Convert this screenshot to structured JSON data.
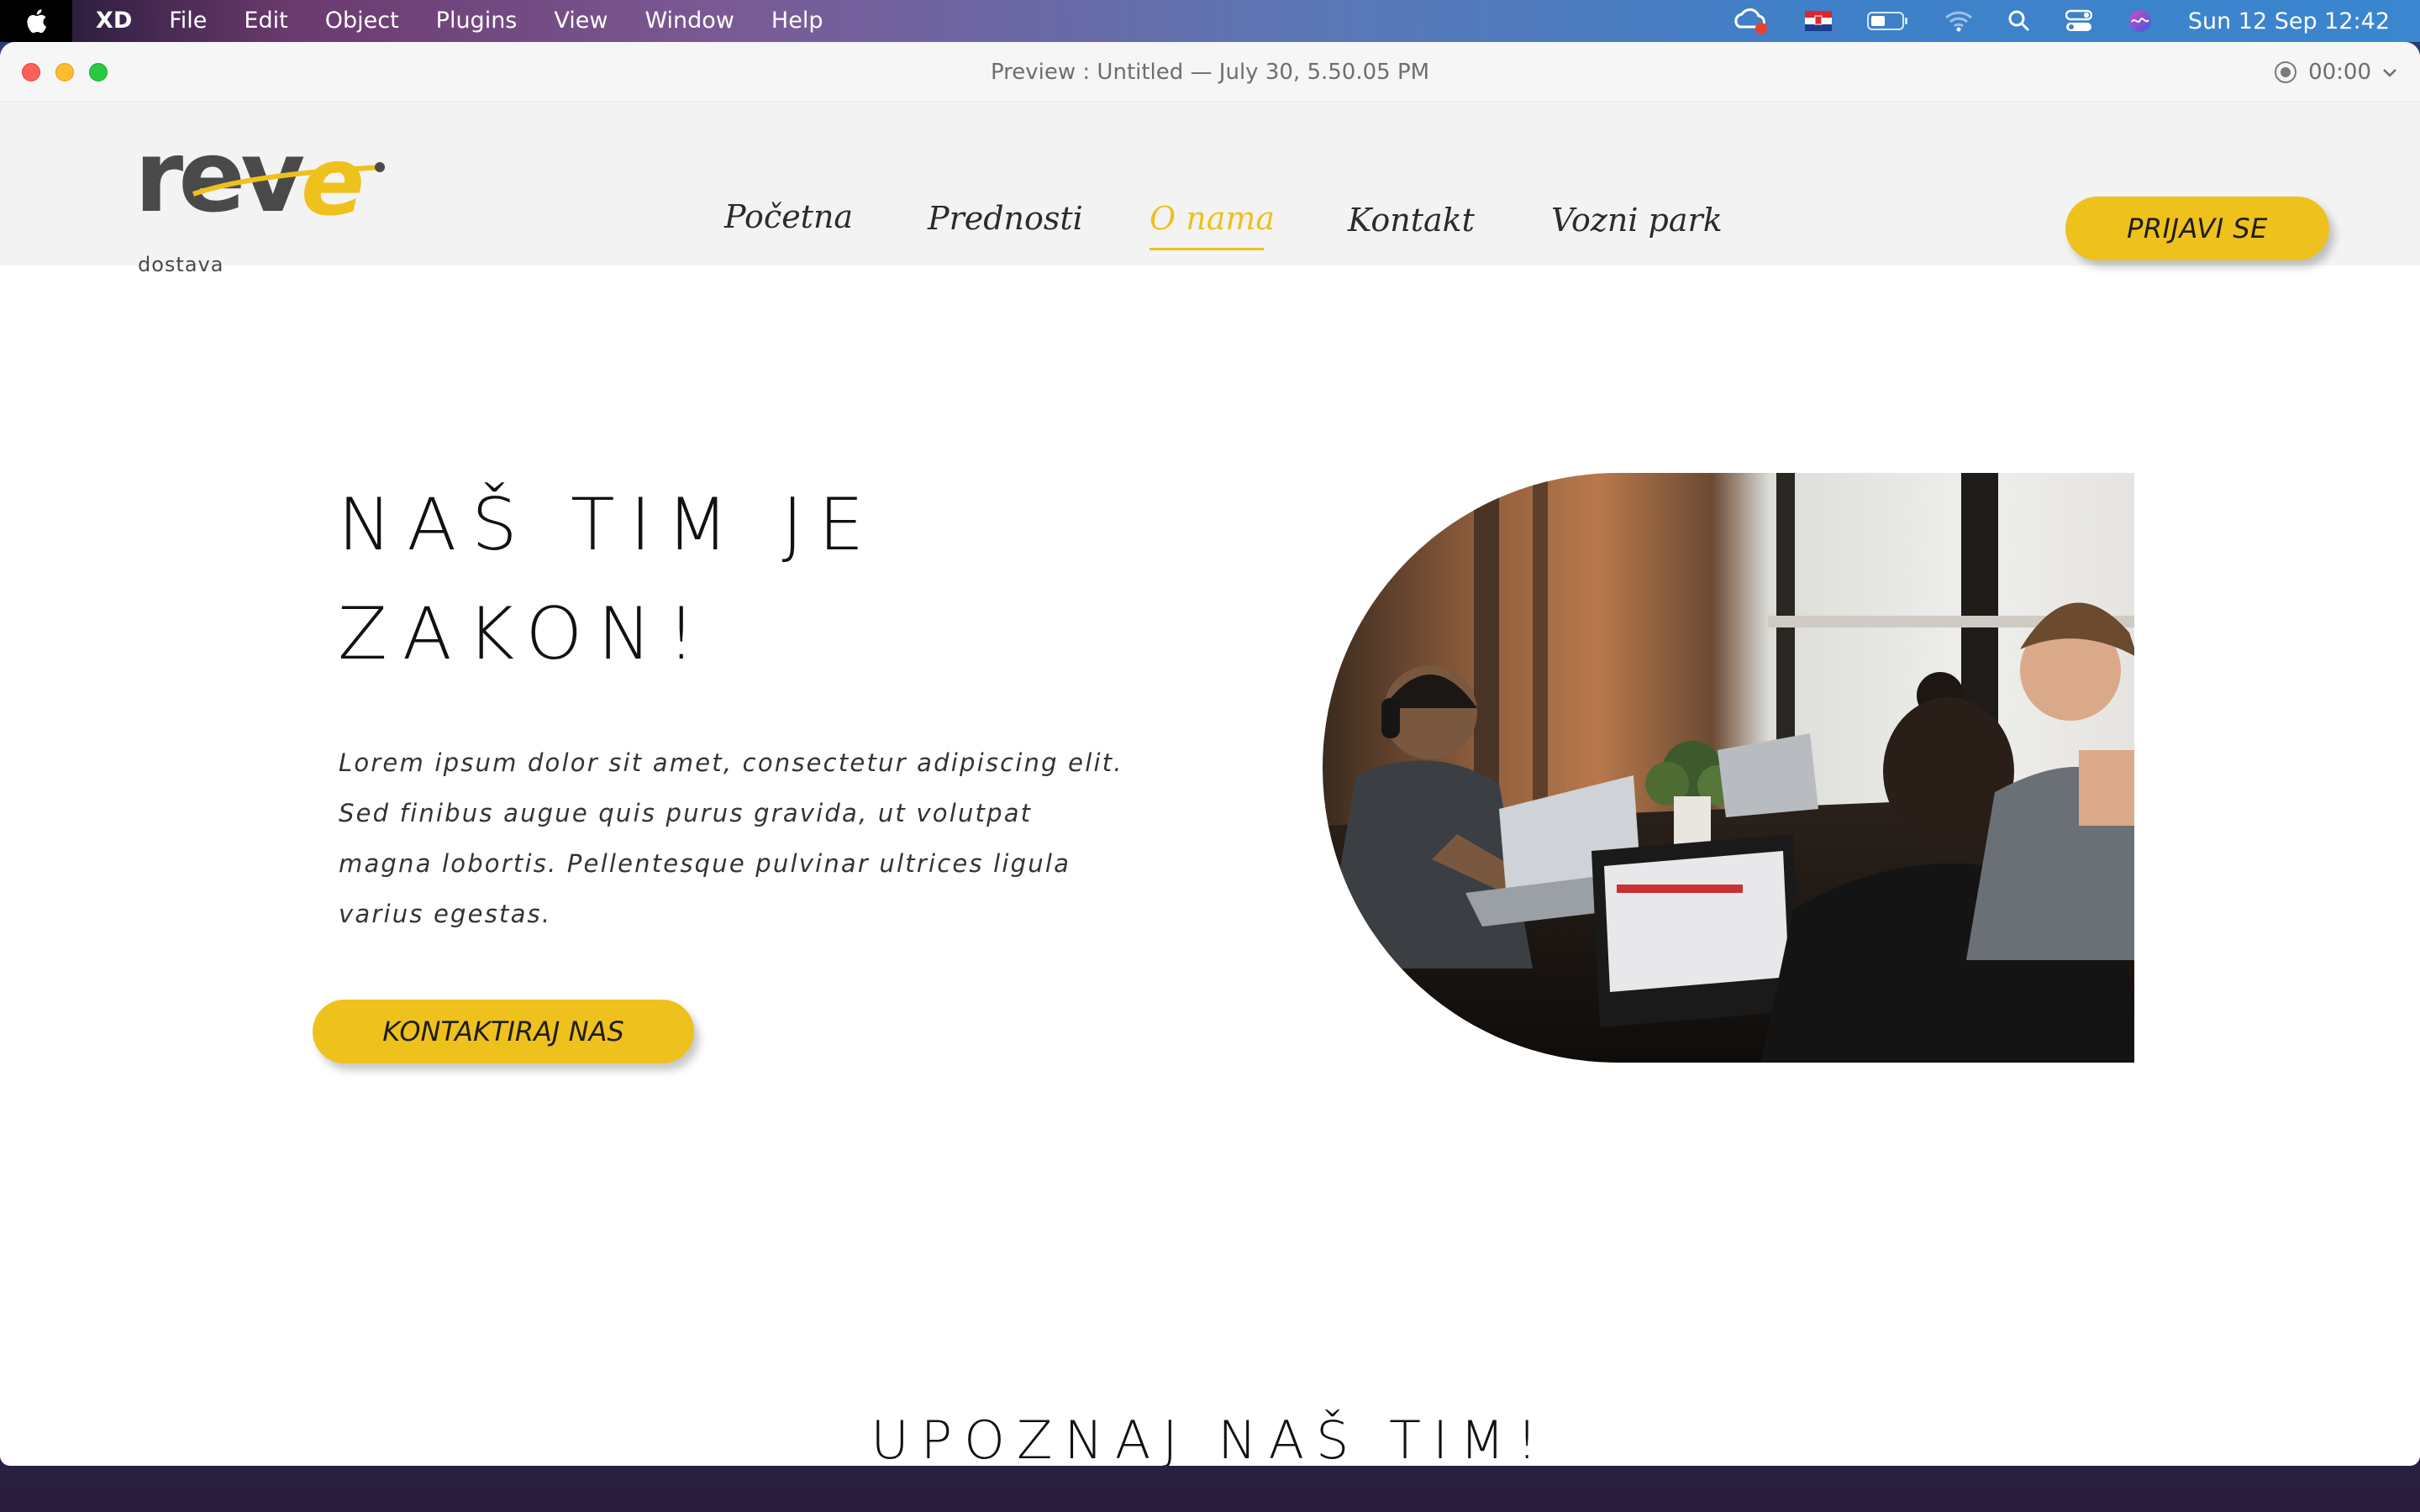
{
  "menubar": {
    "app_name": "XD",
    "items": [
      "File",
      "Edit",
      "Object",
      "Plugins",
      "View",
      "Window",
      "Help"
    ],
    "datetime": "Sun 12 Sep  12:42",
    "icons": [
      "creative-cloud-icon",
      "flag-croatia-icon",
      "battery-icon",
      "wifi-icon",
      "search-icon",
      "control-center-icon",
      "siri-icon"
    ]
  },
  "window": {
    "title": "Preview : Untitled — July 30, 5.50.05 PM",
    "recording_time": "00:00"
  },
  "site": {
    "logo_text": "reve",
    "logo_sub": "dostava",
    "nav": [
      "Početna",
      "Prednosti",
      "O nama",
      "Kontakt",
      "Vozni park"
    ],
    "active_nav": "O nama",
    "login_label": "PRIJAVI SE",
    "hero": {
      "title_line1": "NAŠ TIM JE",
      "title_line2": "ZAKON!",
      "text": "Lorem ipsum dolor sit amet, consectetur adipiscing elit. Sed finibus augue quis purus gravida, ut volutpat magna lobortis. Pellentesque pulvinar ultrices ligula varius egestas.",
      "cta_label": "KONTAKTIRAJ NAS"
    },
    "section_title": "UPOZNAJ NAŠ TIM!"
  },
  "colors": {
    "accent": "#efc11d",
    "text_dark": "#111111",
    "header_bg": "#f3f3f3"
  }
}
